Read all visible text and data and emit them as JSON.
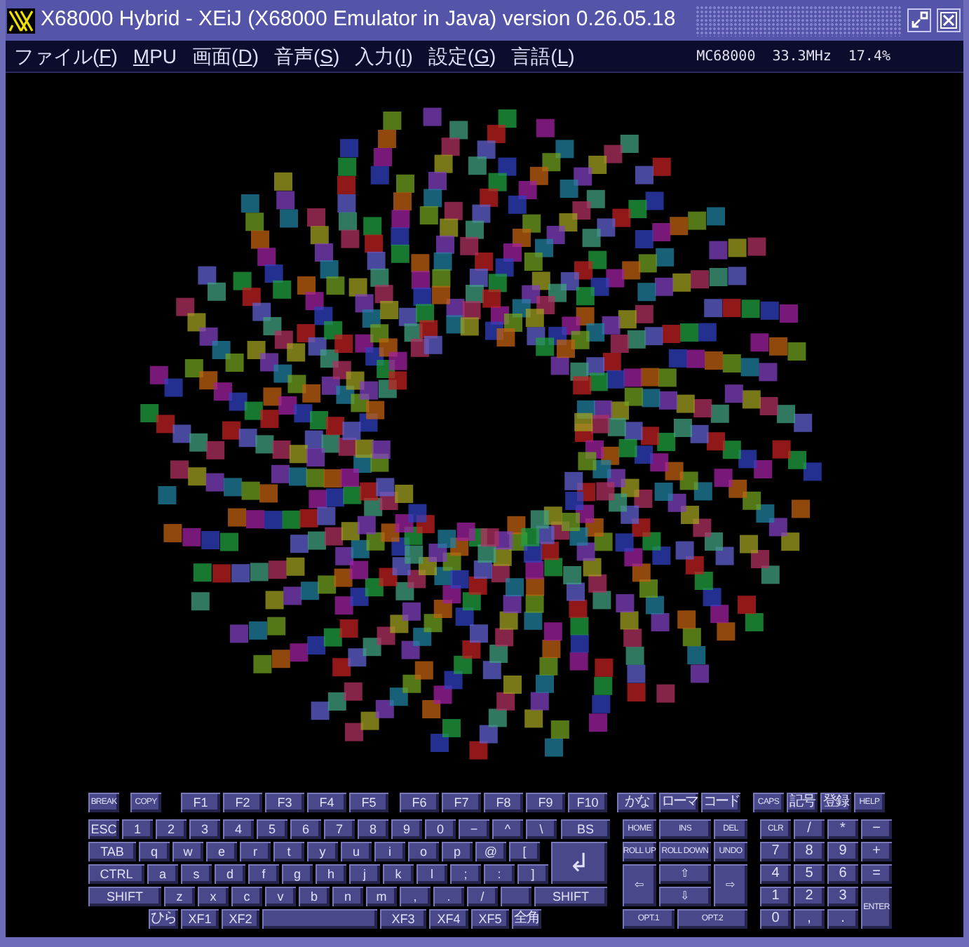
{
  "window": {
    "title": "X68000 Hybrid - XEiJ (X68000 Emulator in Java) version 0.26.05.18"
  },
  "menu": [
    {
      "before": "ファイル(",
      "key": "F",
      "after": ")"
    },
    {
      "key": "M",
      "after": "PU"
    },
    {
      "before": "画面(",
      "key": "D",
      "after": ")"
    },
    {
      "before": "音声(",
      "key": "S",
      "after": ")"
    },
    {
      "before": "入力(",
      "key": "I",
      "after": ")"
    },
    {
      "before": "設定(",
      "key": "G",
      "after": ")"
    },
    {
      "before": "言語(",
      "key": "L",
      "after": ")"
    }
  ],
  "status": [
    "MC68000",
    "33.3MHz",
    "17.4%"
  ],
  "keyboard": {
    "function_row": [
      "BREAK",
      "COPY",
      "F1",
      "F2",
      "F3",
      "F4",
      "F5",
      "F6",
      "F7",
      "F8",
      "F9",
      "F10"
    ],
    "row_1": [
      "ESC",
      "1",
      "2",
      "3",
      "4",
      "5",
      "6",
      "7",
      "8",
      "9",
      "0",
      "−",
      "^",
      "\\",
      "BS"
    ],
    "row_2": [
      "TAB",
      "q",
      "w",
      "e",
      "r",
      "t",
      "y",
      "u",
      "i",
      "o",
      "p",
      "@",
      "["
    ],
    "row_3": [
      "CTRL",
      "a",
      "s",
      "d",
      "f",
      "g",
      "h",
      "j",
      "k",
      "l",
      ";",
      ":",
      "]"
    ],
    "return_key": "↲",
    "row_4": [
      {
        "kind": "key",
        "label": "SHIFT"
      },
      {
        "kind": "key",
        "label": "z"
      },
      {
        "kind": "key",
        "label": "x"
      },
      {
        "kind": "key",
        "label": "c"
      },
      {
        "kind": "key",
        "label": "v"
      },
      {
        "kind": "key",
        "label": "b"
      },
      {
        "kind": "key",
        "label": "n"
      },
      {
        "kind": "key",
        "label": "m"
      },
      {
        "kind": "key",
        "label": ","
      },
      {
        "kind": "key",
        "label": "."
      },
      {
        "kind": "key",
        "label": "/"
      },
      {
        "kind": "blank"
      },
      {
        "kind": "key",
        "label": "SHIFT"
      }
    ],
    "row_5": [
      {
        "kind": "key",
        "label": "ひら"
      },
      {
        "kind": "key",
        "label": "XF1"
      },
      {
        "kind": "key",
        "label": "XF2"
      },
      {
        "kind": "space"
      },
      {
        "kind": "key",
        "label": "XF3"
      },
      {
        "kind": "key",
        "label": "XF4"
      },
      {
        "kind": "key",
        "label": "XF5"
      },
      {
        "kind": "key",
        "label": "全角"
      }
    ],
    "mode_keys": [
      "かな",
      "ローマ",
      "コード"
    ],
    "symbol_keys": [
      "CAPS",
      "記号",
      "登録",
      "HELP"
    ],
    "cursor_keys": [
      "HOME",
      "INS",
      "DEL",
      "ROLL UP",
      "ROLL DOWN",
      "UNDO",
      "⇦",
      "⇧",
      "⇨",
      "⇩",
      "OPT.1",
      "OPT.2"
    ],
    "numpad": [
      "CLR",
      "/",
      "*",
      "−",
      "7",
      "8",
      "9",
      "+",
      "4",
      "5",
      "6",
      "=",
      "1",
      "2",
      "3",
      "ENTER",
      "0",
      ",",
      "."
    ]
  }
}
